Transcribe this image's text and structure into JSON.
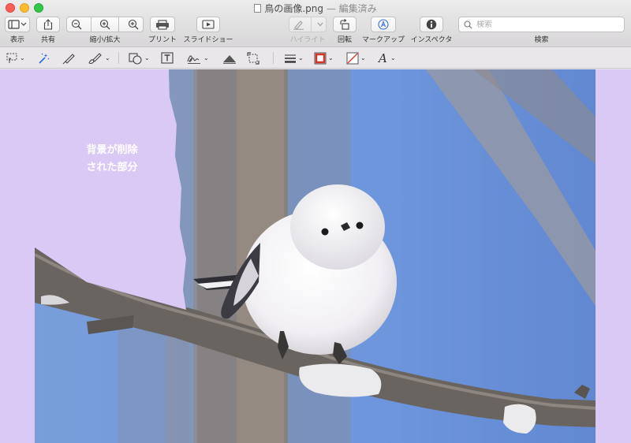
{
  "window": {
    "filename": "鳥の画像.png",
    "separator": " — ",
    "status": "編集済み"
  },
  "toolbar": {
    "view_label": "表示",
    "share_label": "共有",
    "zoom_label": "縮小/拡大",
    "print_label": "プリント",
    "slideshow_label": "スライドショー",
    "highlight_label": "ハイライト",
    "rotate_label": "回転",
    "markup_label": "マークアップ",
    "inspector_label": "インスペクタ",
    "search_label": "検索",
    "search_placeholder": "検索"
  },
  "markup_tools": [
    "selection",
    "instant-alpha",
    "sketch",
    "draw",
    "shapes",
    "text",
    "sign",
    "adjust-color",
    "adjust-size",
    "shape-style",
    "border-color",
    "fill-color",
    "text-style"
  ],
  "colors": {
    "removed_background": "#d9c9f4",
    "sky": "#6f97d9",
    "border_color_swatch": "#d8352a"
  },
  "canvas": {
    "annotation_line1": "背景が削除",
    "annotation_line2": "された部分"
  }
}
